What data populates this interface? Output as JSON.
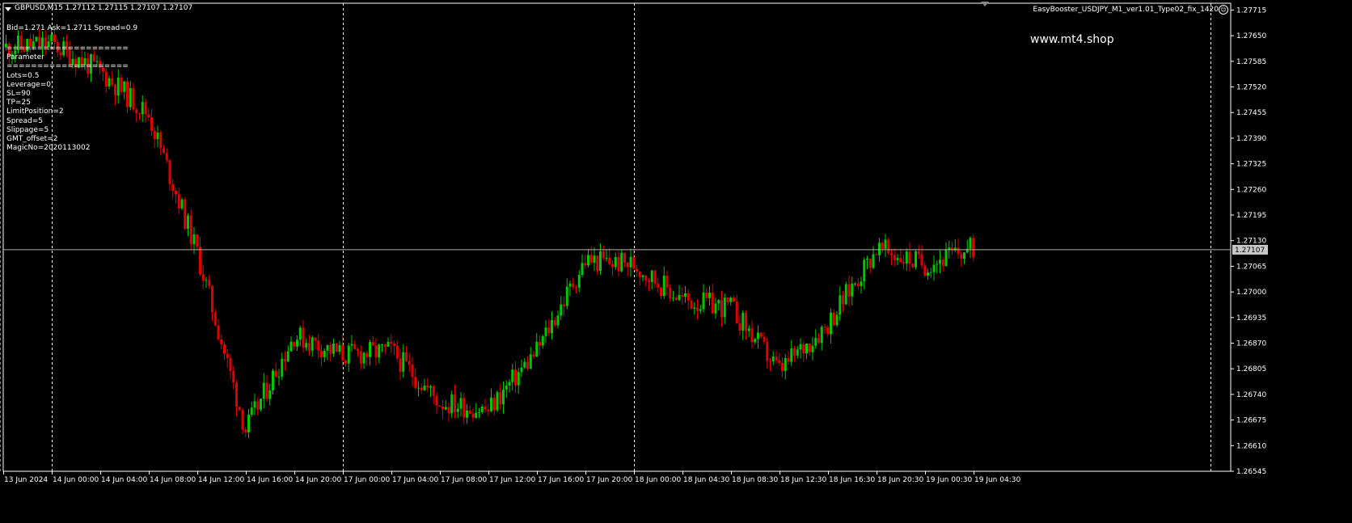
{
  "header": {
    "symbol_line": "GBPUSD,M15  1.27112 1.27115 1.27107 1.27107",
    "quote_line": "Bid=1.271  Ask=1.2711  Spread=0.9",
    "ea_name": "EasyBooster_USDJPY_M1_ver1.01_Type02_fix_1420"
  },
  "params": {
    "separator": "====================",
    "title": "Parameter",
    "items": [
      "Lots=0.5",
      "Leverage=0",
      "SL=90",
      "TP=25",
      "LimitPosition=2",
      "Spread=5",
      "Slippage=5",
      "GMT_offset=2",
      "MagicNo=2020113002"
    ]
  },
  "watermark": "www.mt4.shop",
  "colors": {
    "bull": "#00c800",
    "bear": "#e00000",
    "grid": "#ffffff",
    "axis": "#ffffff",
    "bid_line": "#b0b0b0"
  },
  "chart_data": {
    "type": "candlestick",
    "symbol": "GBPUSD",
    "timeframe": "M15",
    "ylim": [
      1.26545,
      1.2772
    ],
    "y_ticks": [
      "1.27715",
      "1.27650",
      "1.27585",
      "1.27520",
      "1.27455",
      "1.27390",
      "1.27325",
      "1.27260",
      "1.27195",
      "1.27130",
      "1.27065",
      "1.27000",
      "1.26935",
      "1.26870",
      "1.26805",
      "1.26740",
      "1.26675",
      "1.26610",
      "1.26545"
    ],
    "current_price": "1.27107",
    "x_ticks": [
      "13 Jun 2024",
      "14 Jun 00:00",
      "14 Jun 04:00",
      "14 Jun 08:00",
      "14 Jun 12:00",
      "14 Jun 16:00",
      "14 Jun 20:00",
      "17 Jun 00:00",
      "17 Jun 04:00",
      "17 Jun 08:00",
      "17 Jun 12:00",
      "17 Jun 16:00",
      "17 Jun 20:00",
      "18 Jun 00:00",
      "18 Jun 04:30",
      "18 Jun 08:30",
      "18 Jun 12:30",
      "18 Jun 16:30",
      "18 Jun 20:30",
      "19 Jun 00:30",
      "19 Jun 04:30"
    ],
    "day_separators": [
      "14 Jun 00:00",
      "17 Jun 00:00",
      "18 Jun 00:00",
      "19 Jun 00:00"
    ],
    "close_path": [
      {
        "x": "13 Jun 2024",
        "y": 1.2762
      },
      {
        "x": "14 Jun 00:00",
        "y": 1.2763
      },
      {
        "x": "14 Jun 04:00",
        "y": 1.2756
      },
      {
        "x": "14 Jun 08:00",
        "y": 1.2745
      },
      {
        "x": "14 Jun 12:00",
        "y": 1.271
      },
      {
        "x": "14 Jun 16:00",
        "y": 1.2665
      },
      {
        "x": "14 Jun 20:00",
        "y": 1.2689
      },
      {
        "x": "17 Jun 00:00",
        "y": 1.2684
      },
      {
        "x": "17 Jun 04:00",
        "y": 1.2685
      },
      {
        "x": "17 Jun 08:00",
        "y": 1.2672
      },
      {
        "x": "17 Jun 12:00",
        "y": 1.267
      },
      {
        "x": "17 Jun 16:00",
        "y": 1.2685
      },
      {
        "x": "17 Jun 20:00",
        "y": 1.2708
      },
      {
        "x": "18 Jun 00:00",
        "y": 1.2707
      },
      {
        "x": "18 Jun 04:30",
        "y": 1.2698
      },
      {
        "x": "18 Jun 08:30",
        "y": 1.2696
      },
      {
        "x": "18 Jun 12:30",
        "y": 1.268
      },
      {
        "x": "18 Jun 16:30",
        "y": 1.2692
      },
      {
        "x": "18 Jun 20:30",
        "y": 1.2711
      },
      {
        "x": "19 Jun 00:30",
        "y": 1.2707
      },
      {
        "x": "19 Jun 04:30",
        "y": 1.2711
      }
    ]
  }
}
